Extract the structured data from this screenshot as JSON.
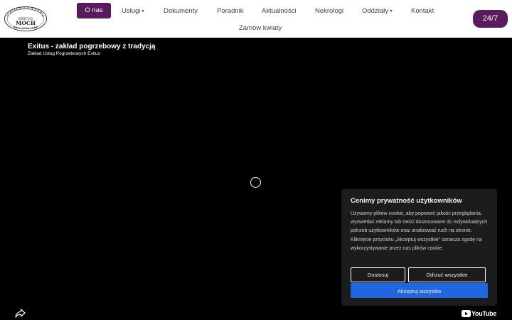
{
  "logo": {
    "arc_text": "FIRMA POGRZEBOWA",
    "name_line1": "EXITUS",
    "name_line2": "MOCH"
  },
  "nav": {
    "items": [
      {
        "label": "O nas",
        "active": true,
        "dropdown": false
      },
      {
        "label": "Usługi",
        "active": false,
        "dropdown": true
      },
      {
        "label": "Dokumenty",
        "active": false,
        "dropdown": false
      },
      {
        "label": "Poradnik",
        "active": false,
        "dropdown": false
      },
      {
        "label": "Aktualności",
        "active": false,
        "dropdown": false
      },
      {
        "label": "Nekrologi",
        "active": false,
        "dropdown": false
      },
      {
        "label": "Oddziały",
        "active": false,
        "dropdown": true
      },
      {
        "label": "Kontakt",
        "active": false,
        "dropdown": false
      },
      {
        "label": "Zamów kwiaty",
        "active": false,
        "dropdown": false
      }
    ],
    "badge": "24/7"
  },
  "video": {
    "title": "Exitus - zakład pogrzebowy z tradycją",
    "subtitle": "Zakład Usług Pogrzebowych Exitus",
    "share_icon": "share-arrow-icon",
    "brand": "YouTube"
  },
  "cookie": {
    "title": "Cenimy prywatność użytkowników",
    "body": "Używamy plików cookie, aby poprawić jakość przeglądania, wyświetlać reklamy lub treści dostosowane do indywidualnych potrzeb użytkowników oraz analizować ruch na stronie. Kliknięcie przycisku „Akceptuj wszystkie” oznacza zgodę na wykorzystywanie przez nas plików cookie.",
    "customize_label": "Dostosuj",
    "reject_label": "Odrzuć wszystkie",
    "accept_label": "Akceptuj wszystko"
  },
  "colors": {
    "brand_purple": "#5a1a5e",
    "accept_blue": "#1f66e0",
    "panel_bg": "#1c1c1f"
  }
}
